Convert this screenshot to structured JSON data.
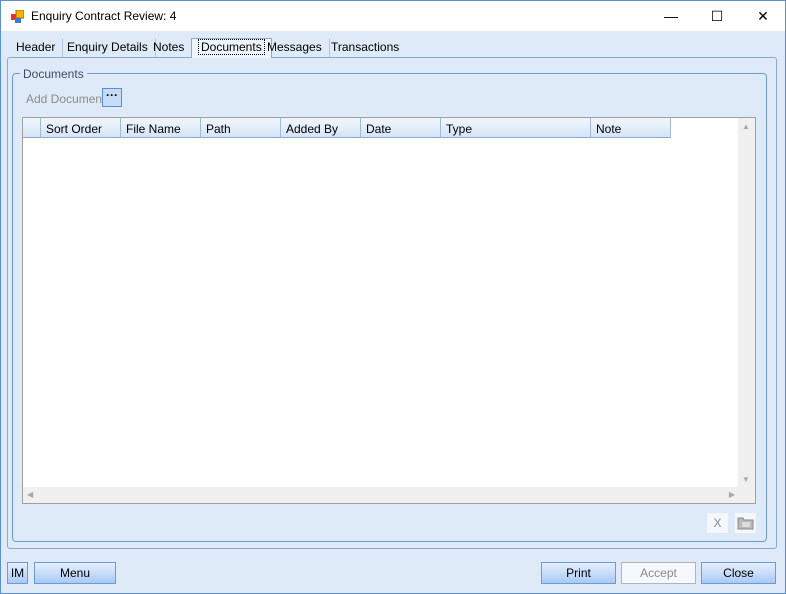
{
  "window": {
    "title": "Enquiry Contract Review: 4",
    "minimize": "—",
    "maximize": "☐",
    "close": "✕"
  },
  "tabs": [
    {
      "label": "Header"
    },
    {
      "label": "Enquiry Details"
    },
    {
      "label": "Notes"
    },
    {
      "label": "Documents"
    },
    {
      "label": "Messages"
    },
    {
      "label": "Transactions"
    }
  ],
  "documents": {
    "group_label": "Documents",
    "add_label": "Add Document",
    "browse_label": "···",
    "columns": [
      "Sort Order",
      "File Name",
      "Path",
      "Added By",
      "Date",
      "Type",
      "Note"
    ],
    "delete_label": "X"
  },
  "footer": {
    "im": "IM",
    "menu": "Menu",
    "print": "Print",
    "accept": "Accept",
    "close": "Close"
  }
}
